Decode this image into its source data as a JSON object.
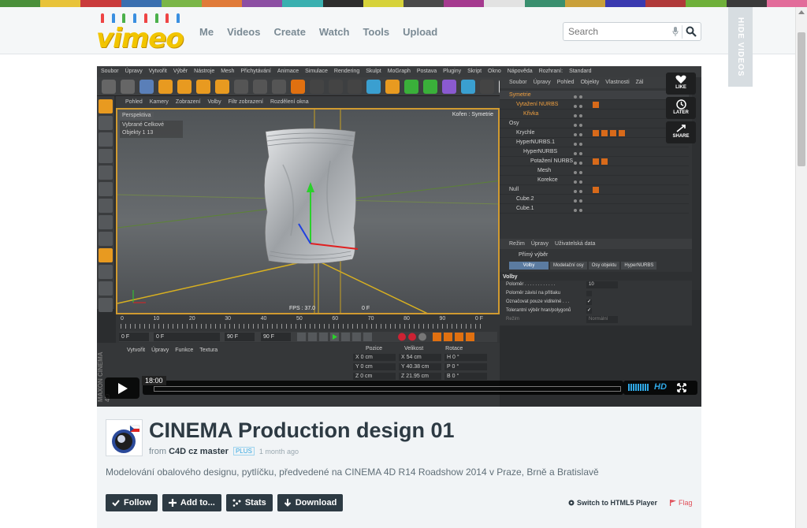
{
  "header": {
    "logo_text": "vimeo",
    "nav": [
      "Me",
      "Videos",
      "Create",
      "Watch",
      "Tools",
      "Upload"
    ],
    "search_placeholder": "Search",
    "hide_videos": "HIDE VIDEOS"
  },
  "stripe_colors": [
    "#4a8f3a",
    "#e8c33a",
    "#c93b3b",
    "#3a6fb0",
    "#7ab648",
    "#e07b39",
    "#8c4fa3",
    "#3ab0b0",
    "#2e2e2e",
    "#d6d23a",
    "#4a4a4a",
    "#a53a8f",
    "#e2e2e2",
    "#3a8f6f",
    "#c9a03a",
    "#3a3ab0",
    "#b03a3a",
    "#6fb03a",
    "#3a3a3a",
    "#e26c9a"
  ],
  "player": {
    "c4d_menu": [
      "Soubor",
      "Úpravy",
      "Vytvořit",
      "Výběr",
      "Nástroje",
      "Mesh",
      "Přichytávání",
      "Animace",
      "Simulace",
      "Rendering",
      "Skulpt",
      "MoGraph",
      "Postava",
      "Pluginy",
      "Skript",
      "Okno",
      "Nápověda",
      "Rozhraní:",
      "Standard"
    ],
    "viewport_menu": [
      "Pohled",
      "Kamery",
      "Zobrazení",
      "Volby",
      "Filtr zobrazení",
      "Rozdělení okna"
    ],
    "viewport_label": "Perspektiva",
    "viewport_info_head": "Vybrané Celkové",
    "viewport_info_row": "Objekty  1         13",
    "camera_label": "Kořen : Symetrie",
    "fps": "FPS : 37.0",
    "frame": "0 F",
    "timeline_numbers": [
      "0",
      "10",
      "20",
      "30",
      "40",
      "50",
      "60",
      "70",
      "80",
      "90"
    ],
    "timeline_end": "0 F",
    "tl_field1": "0 F",
    "tl_field2": "0 F",
    "tl_field3": "90 F",
    "tl_field4": "90 F",
    "bottom_menu": [
      "Vytvořit",
      "Úpravy",
      "Funkce",
      "Textura"
    ],
    "coords_head": [
      "Pozice",
      "Velikost",
      "Rotace"
    ],
    "coords_rows": [
      [
        "X  0 cm",
        "X  54 cm",
        "H  0 °"
      ],
      [
        "Y  0 cm",
        "Y  40.38 cm",
        "P  0 °"
      ],
      [
        "Z  0 cm",
        "Z  21.95 cm",
        "B  0 °"
      ]
    ],
    "m4d": "MAXON CINEMA 4D",
    "objmgr_menu": [
      "Soubor",
      "Úpravy",
      "Pohled",
      "Objekty",
      "Vlastnosti",
      "Zál"
    ],
    "objects": [
      {
        "name": "Symetrie",
        "indent": 0,
        "tags": 0,
        "state": "sel"
      },
      {
        "name": "Vytažení NURBS",
        "indent": 1,
        "tags": 1,
        "state": "sel"
      },
      {
        "name": "Křivka",
        "indent": 2,
        "tags": 0,
        "state": "sel"
      },
      {
        "name": "Osy",
        "indent": 0,
        "tags": 0,
        "state": ""
      },
      {
        "name": "Krychle",
        "indent": 1,
        "tags": 4,
        "state": ""
      },
      {
        "name": "HyperNURBS.1",
        "indent": 1,
        "tags": 0,
        "state": ""
      },
      {
        "name": "HyperNURBS",
        "indent": 2,
        "tags": 0,
        "state": ""
      },
      {
        "name": "Potažení NURBS",
        "indent": 3,
        "tags": 2,
        "state": ""
      },
      {
        "name": "Mesh",
        "indent": 4,
        "tags": 0,
        "state": ""
      },
      {
        "name": "Korekce",
        "indent": 4,
        "tags": 0,
        "state": ""
      },
      {
        "name": "Null",
        "indent": 0,
        "tags": 1,
        "state": ""
      },
      {
        "name": "Cube.2",
        "indent": 1,
        "tags": 0,
        "state": ""
      },
      {
        "name": "Cube.1",
        "indent": 1,
        "tags": 0,
        "state": ""
      }
    ],
    "attr_menu": [
      "Režim",
      "Úpravy",
      "Uživatelská data"
    ],
    "attr_title": "Přímý výběr",
    "attr_tabs": [
      "Volby",
      "Modelační osy",
      "Osy objektu",
      "HyperNURBS"
    ],
    "attr_section": "Volby",
    "attr_props": [
      {
        "label": "Poloměr . . . . . . . . . . . .",
        "value": "10",
        "kind": "value"
      },
      {
        "label": "Poloměr závisí na přítlaku",
        "value": "",
        "kind": "check"
      },
      {
        "label": "Označovat pouze viditelné . . .",
        "value": "✓",
        "kind": "check"
      },
      {
        "label": "Tolerantní výběr hran/polygonů",
        "value": "✓",
        "kind": "check"
      },
      {
        "label": "Režim",
        "value": "Normální",
        "kind": "dim"
      }
    ],
    "social": [
      {
        "label": "LIKE",
        "icon": "heart-icon"
      },
      {
        "label": "LATER",
        "icon": "clock-icon"
      },
      {
        "label": "SHARE",
        "icon": "share-icon"
      }
    ],
    "time_bubble": "18:00",
    "hd_label": "HD"
  },
  "video": {
    "title": "CINEMA Production design 01",
    "from": "from",
    "owner": "C4D cz master",
    "plus": "PLUS",
    "ago": "1 month ago",
    "description": "Modelování obalového designu, pytlíčku, předvedené na CINEMA 4D R14 Roadshow 2014 v Praze, Brně a Bratislavě",
    "actions": [
      {
        "label": "Follow",
        "icon": "check-icon"
      },
      {
        "label": "Add to...",
        "icon": "plus-icon"
      },
      {
        "label": "Stats",
        "icon": "stats-icon"
      },
      {
        "label": "Download",
        "icon": "download-icon"
      }
    ],
    "html5": "Switch to HTML5 Player",
    "flag": "Flag"
  }
}
